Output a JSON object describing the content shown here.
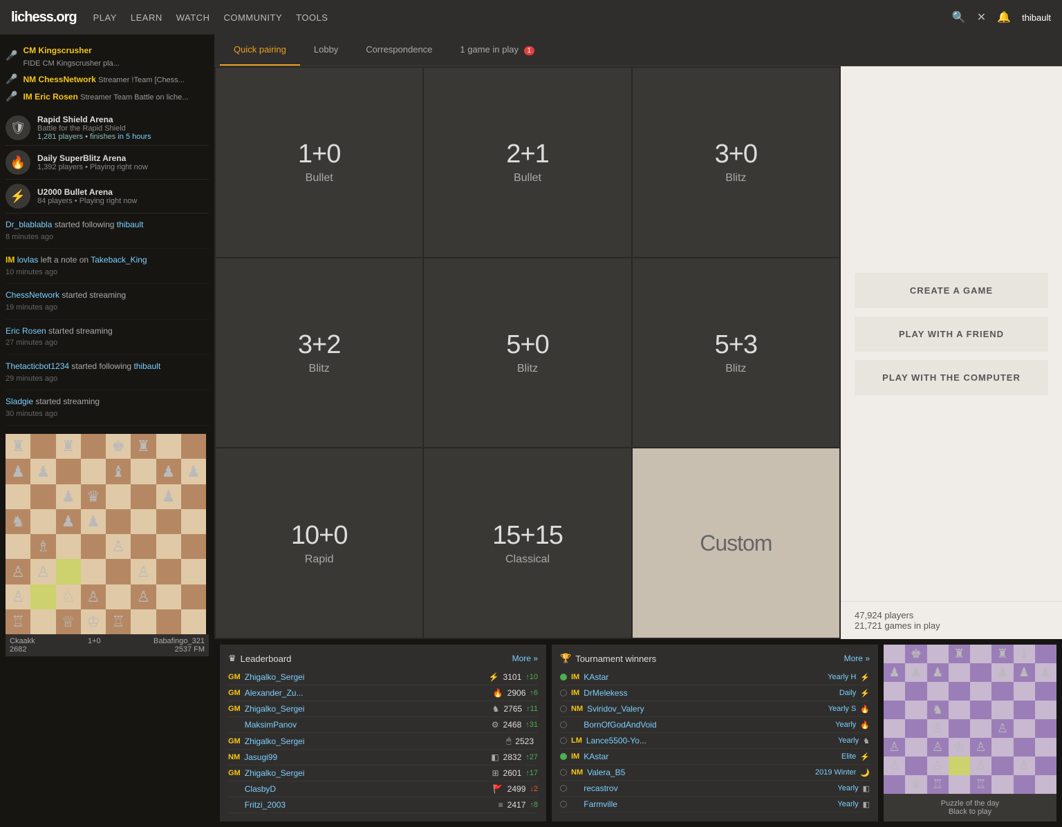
{
  "nav": {
    "logo": "lichess.org",
    "links": [
      "PLAY",
      "LEARN",
      "WATCH",
      "COMMUNITY",
      "TOOLS"
    ],
    "username": "thibault"
  },
  "tabs": [
    {
      "label": "Quick pairing",
      "active": true
    },
    {
      "label": "Lobby",
      "active": false
    },
    {
      "label": "Correspondence",
      "active": false
    },
    {
      "label": "1 game in play",
      "active": false,
      "badge": "1"
    }
  ],
  "pairing": {
    "cells": [
      {
        "time": "1+0",
        "type": "Bullet"
      },
      {
        "time": "2+1",
        "type": "Bullet"
      },
      {
        "time": "3+0",
        "type": "Blitz"
      },
      {
        "time": "3+2",
        "type": "Blitz"
      },
      {
        "time": "5+0",
        "type": "Blitz"
      },
      {
        "time": "5+3",
        "type": "Blitz"
      },
      {
        "time": "10+0",
        "type": "Rapid"
      },
      {
        "time": "15+15",
        "type": "Classical"
      },
      {
        "time": "Custom",
        "type": ""
      }
    ]
  },
  "right_panel": {
    "create_game": "CREATE A GAME",
    "play_friend": "PLAY WITH A FRIEND",
    "play_computer": "PLAY WITH THE COMPUTER",
    "players": "47,924 players",
    "games": "21,721 games in play"
  },
  "streamers": [
    {
      "title": "CM",
      "name": "Kingscrusher",
      "desc": "FIDE CM Kingscrusher pla..."
    },
    {
      "title": "NM",
      "name": "ChessNetwork",
      "desc": "Streamer !Team [Chess..."
    },
    {
      "title": "IM",
      "name": "Eric Rosen",
      "desc": "Streamer Team Battle on liche..."
    }
  ],
  "arenas": [
    {
      "icon": "🛡",
      "title": "Rapid Shield Arena",
      "sub": "Battle for the Rapid Shield",
      "players": "1,281 players",
      "time": "finishes in 5 hours"
    },
    {
      "icon": "🔥",
      "title": "Daily SuperBlitz Arena",
      "sub": "1,392 players • Playing right now"
    },
    {
      "icon": "⚡",
      "title": "U2000 Bullet Arena",
      "sub": "84 players • Playing right now"
    }
  ],
  "activities": [
    {
      "text": "Dr_blablabla started following thibault",
      "time": "8 minutes ago"
    },
    {
      "text": "IM lovlas left a note on Takeback_King",
      "time": "10 minutes ago"
    },
    {
      "text": "ChessNetwork started streaming",
      "time": "19 minutes ago"
    },
    {
      "text": "Eric Rosen started streaming",
      "time": "27 minutes ago"
    },
    {
      "text": "Thetacticbot1234 started following thibault",
      "time": "29 minutes ago"
    },
    {
      "text": "Sladgie started streaming",
      "time": "30 minutes ago"
    }
  ],
  "leaderboard": {
    "title": "Leaderboard",
    "more": "More »",
    "rows": [
      {
        "title": "GM",
        "name": "Zhigalko_Sergei",
        "icon": "⚡",
        "rating": "3101",
        "progress": "↑10"
      },
      {
        "title": "GM",
        "name": "Alexander_Zu...",
        "icon": "🔥",
        "rating": "2906",
        "progress": "↑6"
      },
      {
        "title": "GM",
        "name": "Zhigalko_Sergei",
        "icon": "♞",
        "rating": "2765",
        "progress": "↑11"
      },
      {
        "title": "",
        "name": "MaksimPanov",
        "icon": "⚙",
        "rating": "2468",
        "progress": "↑31"
      },
      {
        "title": "GM",
        "name": "Zhigalko_Sergei",
        "icon": "🖱",
        "rating": "2523",
        "progress": ""
      },
      {
        "title": "NM",
        "name": "Jasugi99",
        "icon": "◧",
        "rating": "2832",
        "progress": "↑27"
      },
      {
        "title": "GM",
        "name": "Zhigalko_Sergei",
        "icon": "⊞",
        "rating": "2601",
        "progress": "↑17"
      },
      {
        "title": "",
        "name": "ClasbyD",
        "icon": "🚩",
        "rating": "2499",
        "progress": "↓2"
      },
      {
        "title": "",
        "name": "Fritzi_2003",
        "icon": "≡",
        "rating": "2417",
        "progress": "↑8"
      }
    ]
  },
  "tournament_winners": {
    "title": "Tournament winners",
    "more": "More »",
    "rows": [
      {
        "online": true,
        "title": "IM",
        "name": "KAstar",
        "tournament": "Yearly H",
        "icon": "⚡"
      },
      {
        "online": false,
        "title": "IM",
        "name": "DrMelekess",
        "tournament": "Daily",
        "icon": "⚡"
      },
      {
        "online": false,
        "title": "NM",
        "name": "Sviridov_Valery",
        "tournament": "Yearly S",
        "icon": "🔥"
      },
      {
        "online": false,
        "title": "",
        "name": "BornOfGodAndVoid",
        "tournament": "Yearly",
        "icon": "🔥"
      },
      {
        "online": false,
        "title": "LM",
        "name": "Lance5500-Yo...",
        "tournament": "Yearly",
        "icon": "♞"
      },
      {
        "online": true,
        "title": "IM",
        "name": "KAstar",
        "tournament": "Elite",
        "icon": "⚡"
      },
      {
        "online": false,
        "title": "NM",
        "name": "Valera_B5",
        "tournament": "2019 Winter",
        "icon": "🌙"
      },
      {
        "online": false,
        "title": "",
        "name": "recastrov",
        "tournament": "Yearly",
        "icon": "◧"
      },
      {
        "online": false,
        "title": "",
        "name": "Farmville",
        "tournament": "Yearly",
        "icon": "◧"
      }
    ]
  },
  "board_bottom": {
    "white": "Ckaakk",
    "white_rating": "2682",
    "time_control": "1+0",
    "black": "Babafingo_321",
    "black_rating": "2537 FM"
  },
  "puzzle": {
    "title": "Puzzle of the day",
    "subtitle": "Black to play"
  }
}
